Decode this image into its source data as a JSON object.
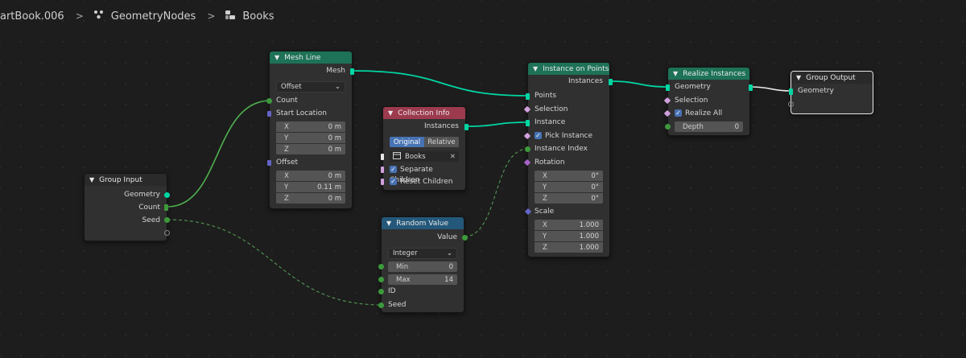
{
  "breadcrumbs": [
    {
      "label": "artBook.006",
      "icon": "object-icon"
    },
    {
      "label": "GeometryNodes",
      "icon": "geometry-nodes-icon"
    },
    {
      "label": "Books",
      "icon": "node-tree-icon"
    }
  ],
  "colors": {
    "geometry_socket": "#00d6a3",
    "integer_socket": "#3c9a3c",
    "vector_socket": "#6363c7",
    "boolean_socket": "#d0a0dc",
    "geometry_header": "#1d7257",
    "input_header": "#9c3a4e",
    "function_header": "#24587a",
    "checkbox": "#4772b3"
  },
  "nodes": {
    "group_input": {
      "title": "Group Input",
      "outputs": [
        "Geometry",
        "Count",
        "Seed"
      ]
    },
    "mesh_line": {
      "title": "Mesh Line",
      "output": "Mesh",
      "mode": "Offset",
      "count_label": "Count",
      "start_location_label": "Start Location",
      "start_location": [
        {
          "axis": "X",
          "value": "0 m"
        },
        {
          "axis": "Y",
          "value": "0 m"
        },
        {
          "axis": "Z",
          "value": "0 m"
        }
      ],
      "offset_label": "Offset",
      "offset": [
        {
          "axis": "X",
          "value": "0 m"
        },
        {
          "axis": "Y",
          "value": "0.11 m"
        },
        {
          "axis": "Z",
          "value": "0 m"
        }
      ]
    },
    "collection_info": {
      "title": "Collection Info",
      "output": "Instances",
      "transform_original": "Original",
      "transform_relative": "Relative",
      "collection": "Books",
      "separate_children": "Separate Children",
      "reset_children": "Reset Children"
    },
    "random_value": {
      "title": "Random Value",
      "output": "Value",
      "data_type": "Integer",
      "min_label": "Min",
      "min": "0",
      "max_label": "Max",
      "max": "14",
      "id_label": "ID",
      "seed_label": "Seed"
    },
    "instance_on_points": {
      "title": "Instance on Points",
      "output": "Instances",
      "points": "Points",
      "selection": "Selection",
      "instance": "Instance",
      "pick_instance": "Pick Instance",
      "instance_index": "Instance Index",
      "rotation_label": "Rotation",
      "rotation": [
        {
          "axis": "X",
          "value": "0°"
        },
        {
          "axis": "Y",
          "value": "0°"
        },
        {
          "axis": "Z",
          "value": "0°"
        }
      ],
      "scale_label": "Scale",
      "scale": [
        {
          "axis": "X",
          "value": "1.000"
        },
        {
          "axis": "Y",
          "value": "1.000"
        },
        {
          "axis": "Z",
          "value": "1.000"
        }
      ]
    },
    "realize_instances": {
      "title": "Realize Instances",
      "geometry": "Geometry",
      "selection": "Selection",
      "realize_all": "Realize All",
      "depth_label": "Depth",
      "depth": "0"
    },
    "group_output": {
      "title": "Group Output",
      "input": "Geometry"
    }
  }
}
